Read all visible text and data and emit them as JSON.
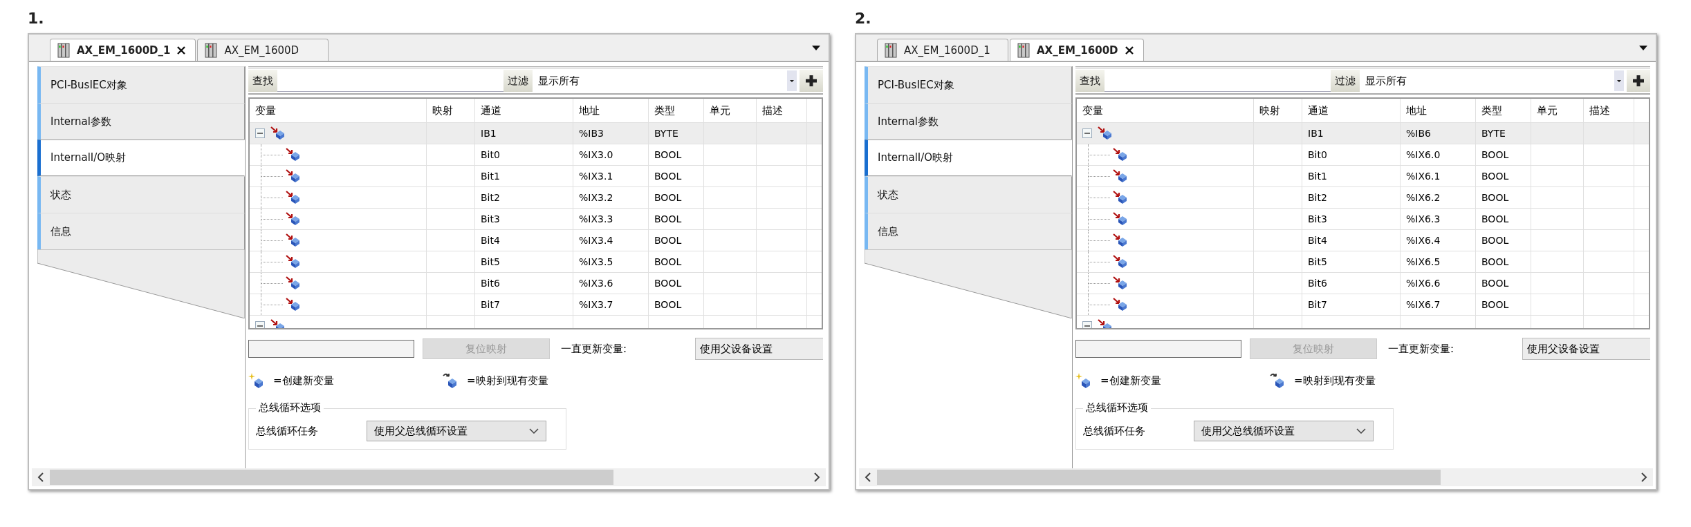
{
  "panels": [
    {
      "number": "1.",
      "tabs": [
        {
          "label": "AX_EM_1600D_1",
          "selected": true
        },
        {
          "label": "AX_EM_1600D",
          "selected": false
        }
      ],
      "sidebar": [
        {
          "label": "PCI-BusIEC对象",
          "selected": false
        },
        {
          "label": "Internal参数",
          "selected": false
        },
        {
          "label": "InternalI/O映射",
          "selected": true
        },
        {
          "label": "状态",
          "selected": false
        },
        {
          "label": "信息",
          "selected": false
        }
      ],
      "search_button": "查找",
      "filter_button": "过滤",
      "filter_value": "显示所有",
      "columns": [
        "变量",
        "映射",
        "通道",
        "地址",
        "类型",
        "单元",
        "描述"
      ],
      "rows": [
        {
          "channel": "IB1",
          "address": "%IB3",
          "type": "BYTE",
          "selected": true,
          "expanded": true,
          "children": [
            {
              "channel": "Bit0",
              "address": "%IX3.0",
              "type": "BOOL",
              "selected": false
            },
            {
              "channel": "Bit1",
              "address": "%IX3.1",
              "type": "BOOL",
              "selected": false
            },
            {
              "channel": "Bit2",
              "address": "%IX3.2",
              "type": "BOOL",
              "selected": false
            },
            {
              "channel": "Bit3",
              "address": "%IX3.3",
              "type": "BOOL",
              "selected": false
            },
            {
              "channel": "Bit4",
              "address": "%IX3.4",
              "type": "BOOL",
              "selected": false
            },
            {
              "channel": "Bit5",
              "address": "%IX3.5",
              "type": "BOOL",
              "selected": false
            },
            {
              "channel": "Bit6",
              "address": "%IX3.6",
              "type": "BOOL",
              "selected": false
            },
            {
              "channel": "Bit7",
              "address": "%IX3.7",
              "type": "BOOL",
              "selected": false
            }
          ]
        },
        {
          "selected": false,
          "expanded": true
        }
      ],
      "reset_button": {
        "label": "复位映射",
        "disabled": true
      },
      "update_label": "一直更新变量:",
      "update_value": "使用父设备设置",
      "legend": [
        {
          "kind": "new",
          "label": "=创建新变量"
        },
        {
          "kind": "map",
          "label": "=映射到现有变量"
        }
      ],
      "bus_group": {
        "title": "总线循环选项",
        "label": "总线循环任务",
        "value": "使用父总线循环设置"
      }
    },
    {
      "number": "2.",
      "tabs": [
        {
          "label": "AX_EM_1600D_1",
          "selected": false
        },
        {
          "label": "AX_EM_1600D",
          "selected": true
        }
      ],
      "sidebar": [
        {
          "label": "PCI-BusIEC对象",
          "selected": false
        },
        {
          "label": "Internal参数",
          "selected": false
        },
        {
          "label": "InternalI/O映射",
          "selected": true
        },
        {
          "label": "状态",
          "selected": false
        },
        {
          "label": "信息",
          "selected": false
        }
      ],
      "search_button": "查找",
      "filter_button": "过滤",
      "filter_value": "显示所有",
      "columns": [
        "变量",
        "映射",
        "通道",
        "地址",
        "类型",
        "单元",
        "描述"
      ],
      "rows": [
        {
          "channel": "IB1",
          "address": "%IB6",
          "type": "BYTE",
          "selected": true,
          "expanded": true,
          "children": [
            {
              "channel": "Bit0",
              "address": "%IX6.0",
              "type": "BOOL",
              "selected": false
            },
            {
              "channel": "Bit1",
              "address": "%IX6.1",
              "type": "BOOL",
              "selected": false
            },
            {
              "channel": "Bit2",
              "address": "%IX6.2",
              "type": "BOOL",
              "selected": false
            },
            {
              "channel": "Bit3",
              "address": "%IX6.3",
              "type": "BOOL",
              "selected": false
            },
            {
              "channel": "Bit4",
              "address": "%IX6.4",
              "type": "BOOL",
              "selected": false
            },
            {
              "channel": "Bit5",
              "address": "%IX6.5",
              "type": "BOOL",
              "selected": false
            },
            {
              "channel": "Bit6",
              "address": "%IX6.6",
              "type": "BOOL",
              "selected": false
            },
            {
              "channel": "Bit7",
              "address": "%IX6.7",
              "type": "BOOL",
              "selected": false
            }
          ]
        },
        {
          "selected": false,
          "expanded": true
        }
      ],
      "reset_button": {
        "label": "复位映射",
        "disabled": true
      },
      "update_label": "一直更新变量:",
      "update_value": "使用父设备设置",
      "legend": [
        {
          "kind": "new",
          "label": "=创建新变量"
        },
        {
          "kind": "map",
          "label": "=映射到现有变量"
        }
      ],
      "bus_group": {
        "title": "总线循环选项",
        "label": "总线循环任务",
        "value": "使用父总线循环设置"
      }
    }
  ]
}
